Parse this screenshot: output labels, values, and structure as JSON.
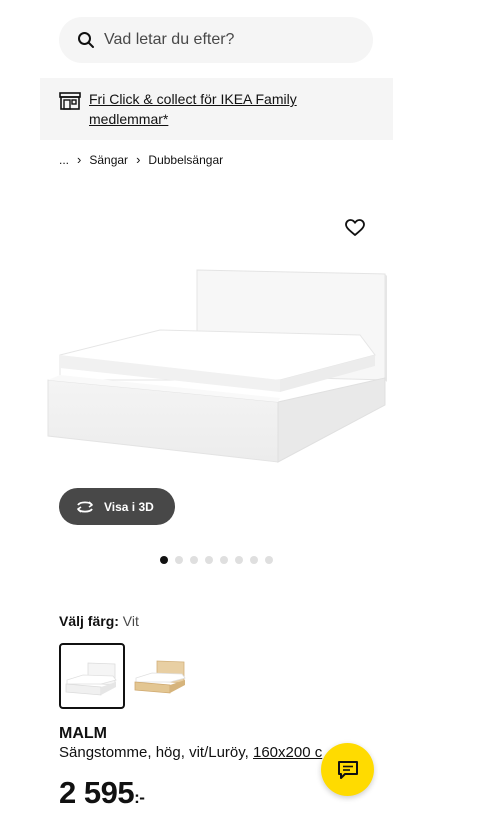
{
  "search": {
    "placeholder": "Vad letar du efter?"
  },
  "banner": {
    "text": "Fri Click & collect för IKEA Family medlemmar*"
  },
  "breadcrumb": {
    "ellipsis": "...",
    "items": [
      "Sängar",
      "Dubbelsängar"
    ]
  },
  "view3d": {
    "label": "Visa i 3D"
  },
  "carousel": {
    "total": 8,
    "active_index": 0
  },
  "color": {
    "label": "Välj färg:",
    "value": "Vit"
  },
  "product": {
    "name": "MALM",
    "description": "Sängstomme, hög, vit/Luröy,",
    "size_link": "160x200 c",
    "price": "2 595",
    "price_suffix": ":-"
  },
  "colors": {
    "accent_yellow": "#ffdb00",
    "dark_button": "#484848",
    "light_bg": "#f5f5f5"
  },
  "icons": [
    "search-icon",
    "store-icon",
    "heart-icon",
    "rotate-3d-icon",
    "chat-icon"
  ]
}
